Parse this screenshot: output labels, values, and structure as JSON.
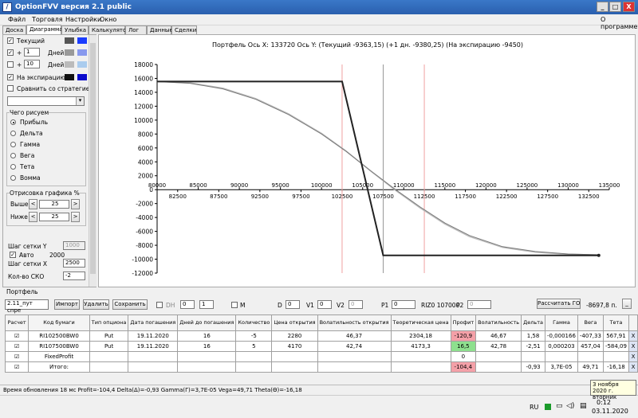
{
  "window": {
    "title": "OptionFVV версия 2.1 public",
    "minimize": "_",
    "maximize": "□",
    "close": "X"
  },
  "menu": {
    "items": [
      "Файл",
      "Торговля",
      "Настройки",
      "Окно"
    ],
    "about": "О программе"
  },
  "tabs": [
    "Доска",
    "Диаграмма",
    "Улыбка",
    "Калькулятор",
    "Лог",
    "Данные",
    "Сделки"
  ],
  "left": {
    "current_label": "Текущий",
    "plus1": "+",
    "plus1_val": "1",
    "plus1_unit": "Дней",
    "plus2": "+",
    "plus2_val": "10",
    "plus2_unit": "Дней",
    "expiry_label": "На экспирацию",
    "compare_label": "Сравнить со стратегией",
    "what_title": "Чего рисуем",
    "radios": [
      "Прибыль",
      "Дельта",
      "Гамма",
      "Вега",
      "Тета",
      "Вомма"
    ],
    "draw_title": "Отрисовка графика %",
    "above_label": "Выше",
    "above_val": "25",
    "below_label": "Ниже",
    "below_val": "25",
    "grid_y_label": "Шаг сетки Y",
    "grid_y_val": "1000",
    "auto_label": "Авто",
    "auto_val": "2000",
    "grid_x_label": "Шаг сетки X",
    "grid_x_val": "2500",
    "sko_label": "Кол-во СКО",
    "sko_val": "-2",
    "colors": {
      "current": "#1a3cff",
      "plus1": "#8899ee",
      "plus2": "#aaccee",
      "expiry": "#0a0acc"
    }
  },
  "chart_header": "Портфель  Ось X: 133720 Ось Y:  (Текущий -9363,15)  (+1 дн. -9380,25)  (На экспирацию -9450)",
  "chart_data": {
    "type": "line",
    "xlim": [
      80000,
      135000
    ],
    "ylim": [
      -12000,
      18000
    ],
    "x_ticks_top": [
      "80000",
      "85000",
      "90000",
      "95000",
      "100000",
      "105000",
      "110000",
      "115000",
      "120000",
      "125000",
      "130000",
      "135000"
    ],
    "x_ticks_bottom": [
      "82500",
      "87500",
      "92500",
      "97500",
      "102500",
      "107500",
      "112500",
      "117500",
      "122500",
      "127500",
      "132500"
    ],
    "y_ticks": [
      "18000",
      "16000",
      "14000",
      "12000",
      "10000",
      "8000",
      "6000",
      "4000",
      "2000",
      "0",
      "-2000",
      "-4000",
      "-6000",
      "-8000",
      "-10000",
      "-12000"
    ],
    "red_lines_x": [
      102500,
      112500
    ],
    "current_x": 107500,
    "expiry": {
      "x": [
        80000,
        102500,
        107500,
        133720
      ],
      "y": [
        15550,
        15550,
        -9450,
        -9450
      ]
    },
    "current": {
      "x": [
        80000,
        84000,
        88000,
        92000,
        96000,
        100000,
        103000,
        106000,
        109000,
        112000,
        115000,
        118000,
        122000,
        126000,
        130000,
        133720
      ],
      "y": [
        15550,
        15300,
        14500,
        13000,
        10800,
        8000,
        5500,
        2700,
        0,
        -2500,
        -4800,
        -6600,
        -8200,
        -8900,
        -9250,
        -9363
      ]
    },
    "plus1": {
      "x": [
        80000,
        84000,
        88000,
        92000,
        96000,
        100000,
        103000,
        106000,
        109000,
        112000,
        115000,
        118000,
        122000,
        126000,
        130000,
        133720
      ],
      "y": [
        15550,
        15350,
        14600,
        13100,
        10900,
        8100,
        5550,
        2650,
        -100,
        -2650,
        -4950,
        -6750,
        -8300,
        -9000,
        -9300,
        -9380
      ]
    }
  },
  "portfolio": {
    "title": "Портфель",
    "select_val": "2.11_пут спре",
    "import": "Импорт",
    "delete": "Удалить",
    "save": "Сохранить",
    "dh": "DH",
    "dh_val1": "0",
    "dh_val2": "1",
    "m": "M",
    "d_label": "D",
    "d_val": "0",
    "v1_label": "V1",
    "v1_val": "0",
    "v2_label": "V2",
    "v2_val": "0",
    "p1_label": "P1",
    "p1_val": "0",
    "riz_label": "RIZ0 107000",
    "p2_label": "P2",
    "p2_val": "0",
    "calc_go": "Рассчитать ГО",
    "go_val": "-8697,8 п.",
    "columns": [
      "Расчет",
      "Код бумаги",
      "Тип опциона",
      "Дата погашения",
      "Дней до погашения",
      "Количество",
      "Цена открытия",
      "Волатильность открытия",
      "Теоретическая цена",
      "Профит",
      "Волатильность",
      "Дельта",
      "Гамма",
      "Вега",
      "Тета",
      ""
    ],
    "rows": [
      {
        "code": "RI102500BW0",
        "type": "Put",
        "date": "19.11.2020",
        "days": "16",
        "qty": "-5",
        "price": "2280",
        "vol": "46,37",
        "theo": "2304,18",
        "profit": "-120,9",
        "curvol": "46,67",
        "delta": "1,58",
        "gamma": "-0,000166",
        "vega": "-407,33",
        "theta": "567,91",
        "x": "X"
      },
      {
        "code": "RI107500BW0",
        "type": "Put",
        "date": "19.11.2020",
        "days": "16",
        "qty": "5",
        "price": "4170",
        "vol": "42,74",
        "theo": "4173,3",
        "profit": "16,5",
        "curvol": "42,78",
        "delta": "-2,51",
        "gamma": "0,000203",
        "vega": "457,04",
        "theta": "-584,09",
        "x": "X"
      },
      {
        "code": "FixedProfit",
        "profit": "0",
        "x": "X"
      },
      {
        "code": "Итого:",
        "profit": "-104,4",
        "delta": "-0,93",
        "gamma": "3,7E-05",
        "vega": "49,71",
        "theta": "-16,18",
        "x": "X"
      }
    ]
  },
  "status": "Время обновления 18 мс  Profit=-104,4 Delta(Δ)=-0,93 Gamma(Γ)=3,7E-05 Vega=49,71 Theta(Θ)=-16,18",
  "tooltip": {
    "line1": "3 ноября 2020 г.",
    "line2": "вторник"
  },
  "taskbar": {
    "lang": "RU",
    "time": "0:12",
    "date": "03.11.2020"
  }
}
